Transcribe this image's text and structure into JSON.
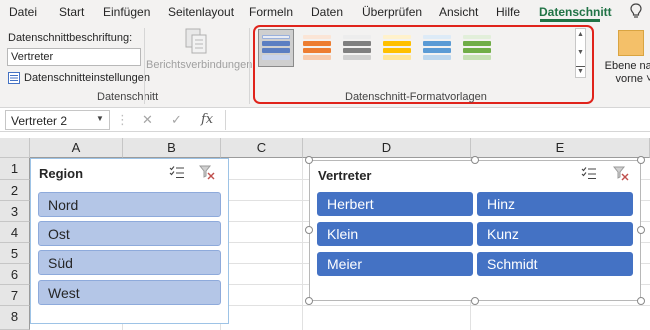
{
  "ribbon_tabs": [
    {
      "label": "Datei",
      "active": false
    },
    {
      "label": "Start",
      "active": false
    },
    {
      "label": "Einfügen",
      "active": false
    },
    {
      "label": "Seitenlayout",
      "active": false
    },
    {
      "label": "Formeln",
      "active": false
    },
    {
      "label": "Daten",
      "active": false
    },
    {
      "label": "Überprüfen",
      "active": false
    },
    {
      "label": "Ansicht",
      "active": false
    },
    {
      "label": "Hilfe",
      "active": false
    },
    {
      "label": "Datenschnitt",
      "active": true
    }
  ],
  "ribbon": {
    "caption_label": "Datenschnittbeschriftung:",
    "caption_value": "Vertreter",
    "settings_label": "Datenschnitteinstellungen",
    "group1_label": "Datenschnitt",
    "report_connections_label": "Berichtsverbindungen",
    "styles_group_label": "Datenschnitt-Formatvorlagen",
    "style_colors": [
      "#5b7ec2",
      "#ed7d31",
      "#808080",
      "#ffc000",
      "#5b9bd5",
      "#70ad47"
    ],
    "arrange_label_line1": "Ebene nach",
    "arrange_label_line2": "vorne"
  },
  "formula_bar": {
    "name_box": "Vertreter 2",
    "cancel_icon": "✕",
    "enter_icon": "✓",
    "fx_label": "fx",
    "formula": ""
  },
  "grid": {
    "columns": [
      "A",
      "B",
      "C",
      "D",
      "E"
    ],
    "rows": [
      "1",
      "2",
      "3",
      "4",
      "5",
      "6",
      "7",
      "8"
    ]
  },
  "slicers": {
    "region": {
      "title": "Region",
      "items": [
        "Nord",
        "Ost",
        "Süd",
        "West"
      ]
    },
    "vertreter": {
      "title": "Vertreter",
      "items": [
        "Herbert",
        "Hinz",
        "Klein",
        "Kunz",
        "Meier",
        "Schmidt"
      ]
    }
  },
  "colors": {
    "accent_green": "#217346",
    "highlight_red": "#e0231b",
    "slicer_selected_blue": "#4472c4",
    "slicer_light_blue": "#b4c6e7"
  }
}
